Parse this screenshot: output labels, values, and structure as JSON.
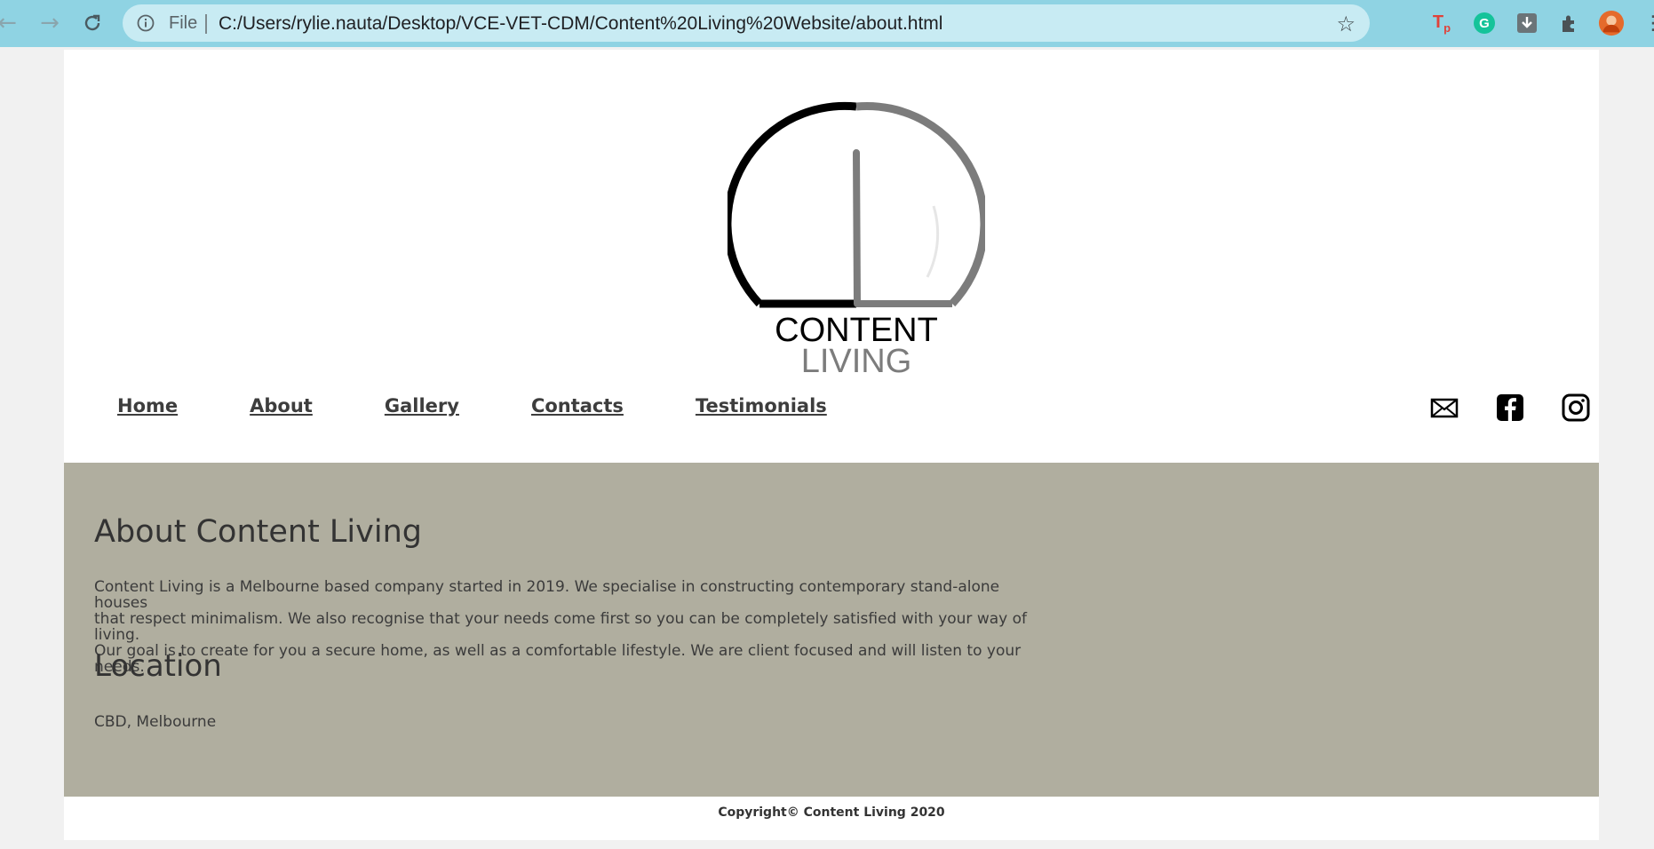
{
  "browser": {
    "scheme_label": "File",
    "url": "C:/Users/rylie.nauta/Desktop/VCE-VET-CDM/Content%20Living%20Website/about.html",
    "icons": [
      "back-icon",
      "forward-icon",
      "reload-icon",
      "info-icon",
      "star-icon",
      "extension-tp-icon",
      "grammarly-icon",
      "download-icon",
      "puzzle-icon",
      "profile-avatar"
    ]
  },
  "logo": {
    "line1": "CONTENT",
    "line2": "LIVING"
  },
  "nav": {
    "items": [
      {
        "label": "Home"
      },
      {
        "label": "About"
      },
      {
        "label": "Gallery"
      },
      {
        "label": "Contacts"
      },
      {
        "label": "Testimonials"
      }
    ]
  },
  "social": {
    "icons": [
      "mail-icon",
      "facebook-icon",
      "instagram-icon"
    ]
  },
  "main": {
    "heading": "About Content Living",
    "about_lines": [
      "Content Living is a Melbourne based company started in 2019. We specialise in constructing contemporary stand-alone houses",
      "that respect minimalism. We also recognise that your needs come first so you can be completely satisfied with your way of living.",
      "Our goal is to create for you a secure home, as well as a comfortable lifestyle. We are client focused and will listen to your needs."
    ],
    "location_heading": "Location",
    "location": "CBD, Melbourne"
  },
  "footer": {
    "copyright": "Copyright© Content Living 2020"
  },
  "colors": {
    "chrome": "#8fd3e3",
    "omnibox": "#c8ebf3",
    "content_band": "#b0ae9f",
    "logo_dark": "#000000",
    "logo_grey": "#7c7c7c"
  }
}
